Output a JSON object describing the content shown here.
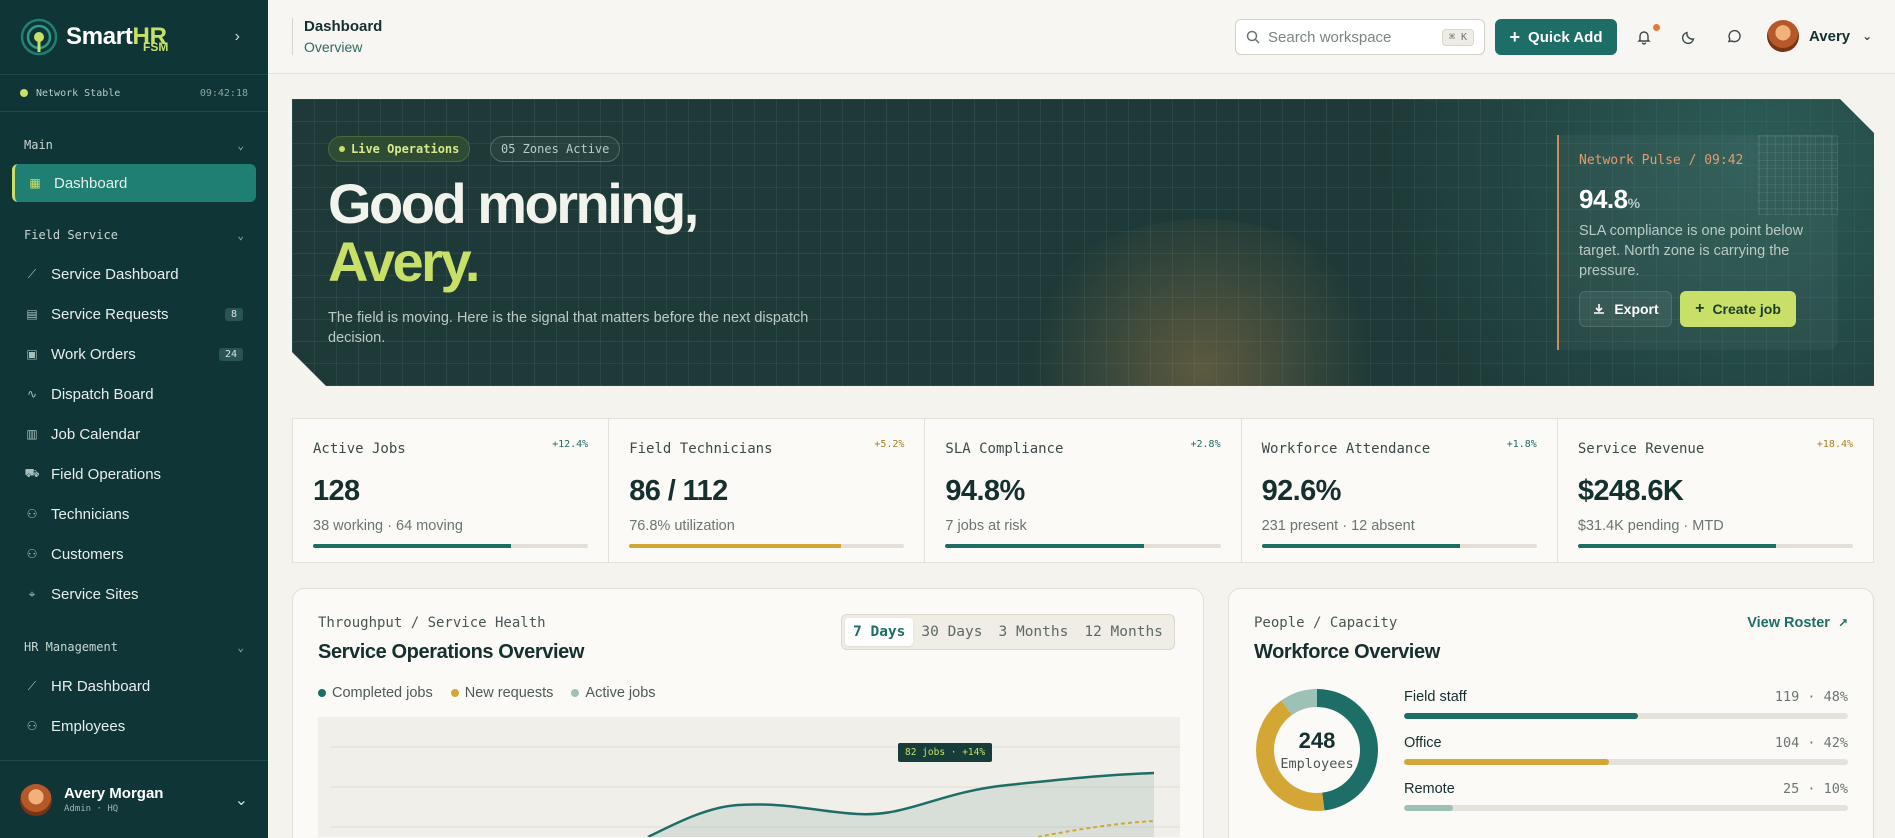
{
  "brand": {
    "name_a": "Smart",
    "name_b": "HR",
    "sub": "FSM"
  },
  "network": {
    "status": "Network Stable",
    "time": "09:42:18"
  },
  "sidebar": {
    "sections": [
      {
        "label": "Main",
        "items": [
          {
            "label": "Dashboard",
            "icon": "grid-icon",
            "active": true
          }
        ]
      },
      {
        "label": "Field Service",
        "items": [
          {
            "label": "Service Dashboard",
            "icon": "chart-line-icon"
          },
          {
            "label": "Service Requests",
            "icon": "clipboard-icon",
            "count": "8"
          },
          {
            "label": "Work Orders",
            "icon": "briefcase-icon",
            "count": "24"
          },
          {
            "label": "Dispatch Board",
            "icon": "route-icon"
          },
          {
            "label": "Job Calendar",
            "icon": "calendar-icon"
          },
          {
            "label": "Field Operations",
            "icon": "truck-icon"
          },
          {
            "label": "Technicians",
            "icon": "user-gear-icon"
          },
          {
            "label": "Customers",
            "icon": "users-icon"
          },
          {
            "label": "Service Sites",
            "icon": "map-pin-icon"
          }
        ]
      },
      {
        "label": "HR Management",
        "items": [
          {
            "label": "HR Dashboard",
            "icon": "chart-line-icon"
          },
          {
            "label": "Employees",
            "icon": "users-icon"
          }
        ]
      }
    ]
  },
  "user": {
    "name": "Avery Morgan",
    "role": "Admin · HQ",
    "short": "Avery"
  },
  "topbar": {
    "title": "Dashboard",
    "subtitle": "Overview",
    "search_placeholder": "Search workspace",
    "search_kbd": "⌘ K",
    "quick_add": "Quick Add"
  },
  "hero": {
    "chip_live": "Live Operations",
    "chip_zones": "05 Zones Active",
    "greeting": "Good morning,",
    "name": "Avery.",
    "sub": "The field is moving. Here is the signal that matters before the next dispatch decision.",
    "pulse_title": "Network Pulse / 09:42",
    "pulse_value": "94.8",
    "pulse_unit": "%",
    "pulse_desc": "SLA compliance is one point below target. North zone is carrying the pressure.",
    "export": "Export",
    "create": "Create job"
  },
  "kpis": [
    {
      "label": "Active Jobs",
      "delta": "+12.4%",
      "value": "128",
      "sub": "38 working · 64 moving",
      "progress": 0.72,
      "color": "#1d6e66",
      "delta_color": "#1d6e66"
    },
    {
      "label": "Field Technicians",
      "delta": "+5.2%",
      "value": "86 / 112",
      "sub": "76.8% utilization",
      "progress": 0.77,
      "color": "#d4a636",
      "delta_color": "#a78223"
    },
    {
      "label": "SLA Compliance",
      "delta": "+2.8%",
      "value": "94.8%",
      "sub": "7 jobs at risk",
      "progress": 0.72,
      "color": "#1d6e66",
      "delta_color": "#1d6e66"
    },
    {
      "label": "Workforce Attendance",
      "delta": "+1.8%",
      "value": "92.6%",
      "sub": "231 present · 12 absent",
      "progress": 0.72,
      "color": "#1d6e66",
      "delta_color": "#1d6e66"
    },
    {
      "label": "Service Revenue",
      "delta": "+18.4%",
      "value": "$248.6K",
      "sub": "$31.4K pending · MTD",
      "progress": 0.72,
      "color": "#1d6e66",
      "delta_color": "#a78223"
    }
  ],
  "service_panel": {
    "label": "Throughput / Service Health",
    "title": "Service Operations Overview",
    "ranges": [
      "7 Days",
      "30 Days",
      "3 Months",
      "12 Months"
    ],
    "active_range": "7 Days",
    "legend": [
      {
        "name": "Completed jobs",
        "color": "#1d6e66"
      },
      {
        "name": "New requests",
        "color": "#d4a636"
      },
      {
        "name": "Active jobs",
        "color": "#9ec1b5"
      }
    ],
    "tooltip": "82 jobs · +14%"
  },
  "workforce_panel": {
    "label": "People / Capacity",
    "title": "Workforce Overview",
    "view_roster": "View Roster",
    "total": "248",
    "total_label": "Employees",
    "rows": [
      {
        "name": "Field staff",
        "value": "119 · 48%",
        "share": 0.48,
        "color": "#1d6e66"
      },
      {
        "name": "Office",
        "value": "104 · 42%",
        "share": 0.42,
        "color": "#d4a636"
      },
      {
        "name": "Remote",
        "value": "25 · 10%",
        "share": 0.1,
        "color": "#9ec1b5"
      }
    ]
  }
}
